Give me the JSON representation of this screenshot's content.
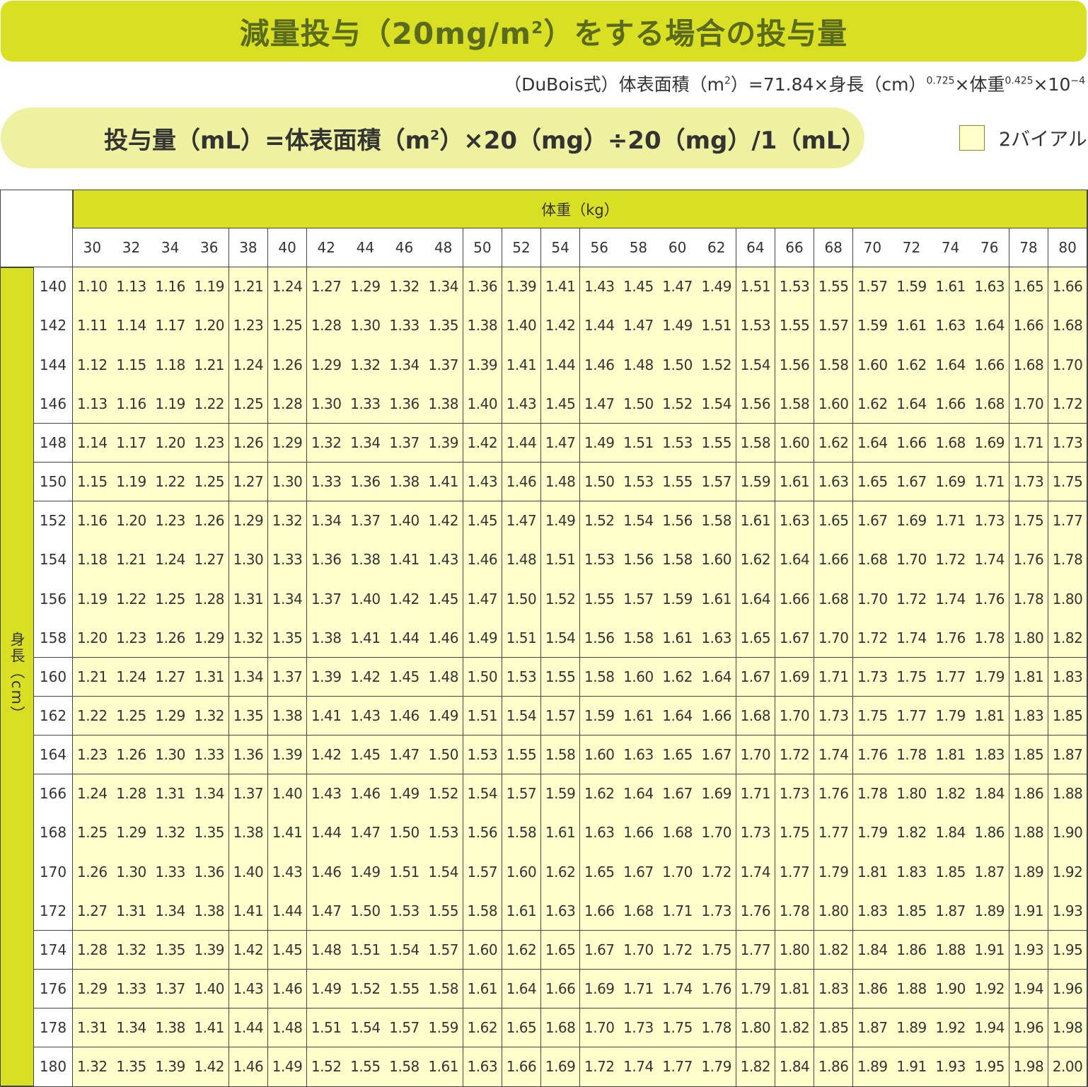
{
  "title": {
    "main": "減量投与（20mg/m",
    "sup": "2",
    "tail": "）をする場合の投与量"
  },
  "formula": {
    "part1": "（DuBois式）体表面積（m",
    "sup1": "2",
    "part2": "）=71.84×身長（cm）",
    "sup2": "0.725",
    "part3": "×体重",
    "sup3": "0.425",
    "part4": "×10",
    "sup4": "−4"
  },
  "dose": {
    "part1": "投与量（mL）=体表面積（m",
    "sup": "2",
    "part2": "）×20（mg）÷20（mg）/1（mL）"
  },
  "legend": {
    "label": "2バイアル",
    "color": "#ffffcc"
  },
  "table": {
    "weight_header": "体重（kg）",
    "height_header": "身長（cm）",
    "weights": [
      "30",
      "32",
      "34",
      "36",
      "38",
      "40",
      "42",
      "44",
      "46",
      "48",
      "50",
      "52",
      "54",
      "56",
      "58",
      "60",
      "62",
      "64",
      "66",
      "68",
      "70",
      "72",
      "74",
      "76",
      "78",
      "80"
    ],
    "heights": [
      "140",
      "142",
      "144",
      "146",
      "148",
      "150",
      "152",
      "154",
      "156",
      "158",
      "160",
      "162",
      "164",
      "166",
      "168",
      "170",
      "172",
      "174",
      "176",
      "178",
      "180"
    ],
    "values": [
      [
        "1.10",
        "1.13",
        "1.16",
        "1.19",
        "1.21",
        "1.24",
        "1.27",
        "1.29",
        "1.32",
        "1.34",
        "1.36",
        "1.39",
        "1.41",
        "1.43",
        "1.45",
        "1.47",
        "1.49",
        "1.51",
        "1.53",
        "1.55",
        "1.57",
        "1.59",
        "1.61",
        "1.63",
        "1.65",
        "1.66"
      ],
      [
        "1.11",
        "1.14",
        "1.17",
        "1.20",
        "1.23",
        "1.25",
        "1.28",
        "1.30",
        "1.33",
        "1.35",
        "1.38",
        "1.40",
        "1.42",
        "1.44",
        "1.47",
        "1.49",
        "1.51",
        "1.53",
        "1.55",
        "1.57",
        "1.59",
        "1.61",
        "1.63",
        "1.64",
        "1.66",
        "1.68"
      ],
      [
        "1.12",
        "1.15",
        "1.18",
        "1.21",
        "1.24",
        "1.26",
        "1.29",
        "1.32",
        "1.34",
        "1.37",
        "1.39",
        "1.41",
        "1.44",
        "1.46",
        "1.48",
        "1.50",
        "1.52",
        "1.54",
        "1.56",
        "1.58",
        "1.60",
        "1.62",
        "1.64",
        "1.66",
        "1.68",
        "1.70"
      ],
      [
        "1.13",
        "1.16",
        "1.19",
        "1.22",
        "1.25",
        "1.28",
        "1.30",
        "1.33",
        "1.36",
        "1.38",
        "1.40",
        "1.43",
        "1.45",
        "1.47",
        "1.50",
        "1.52",
        "1.54",
        "1.56",
        "1.58",
        "1.60",
        "1.62",
        "1.64",
        "1.66",
        "1.68",
        "1.70",
        "1.72"
      ],
      [
        "1.14",
        "1.17",
        "1.20",
        "1.23",
        "1.26",
        "1.29",
        "1.32",
        "1.34",
        "1.37",
        "1.39",
        "1.42",
        "1.44",
        "1.47",
        "1.49",
        "1.51",
        "1.53",
        "1.55",
        "1.58",
        "1.60",
        "1.62",
        "1.64",
        "1.66",
        "1.68",
        "1.69",
        "1.71",
        "1.73"
      ],
      [
        "1.15",
        "1.19",
        "1.22",
        "1.25",
        "1.27",
        "1.30",
        "1.33",
        "1.36",
        "1.38",
        "1.41",
        "1.43",
        "1.46",
        "1.48",
        "1.50",
        "1.53",
        "1.55",
        "1.57",
        "1.59",
        "1.61",
        "1.63",
        "1.65",
        "1.67",
        "1.69",
        "1.71",
        "1.73",
        "1.75"
      ],
      [
        "1.16",
        "1.20",
        "1.23",
        "1.26",
        "1.29",
        "1.32",
        "1.34",
        "1.37",
        "1.40",
        "1.42",
        "1.45",
        "1.47",
        "1.49",
        "1.52",
        "1.54",
        "1.56",
        "1.58",
        "1.61",
        "1.63",
        "1.65",
        "1.67",
        "1.69",
        "1.71",
        "1.73",
        "1.75",
        "1.77"
      ],
      [
        "1.18",
        "1.21",
        "1.24",
        "1.27",
        "1.30",
        "1.33",
        "1.36",
        "1.38",
        "1.41",
        "1.43",
        "1.46",
        "1.48",
        "1.51",
        "1.53",
        "1.56",
        "1.58",
        "1.60",
        "1.62",
        "1.64",
        "1.66",
        "1.68",
        "1.70",
        "1.72",
        "1.74",
        "1.76",
        "1.78"
      ],
      [
        "1.19",
        "1.22",
        "1.25",
        "1.28",
        "1.31",
        "1.34",
        "1.37",
        "1.40",
        "1.42",
        "1.45",
        "1.47",
        "1.50",
        "1.52",
        "1.55",
        "1.57",
        "1.59",
        "1.61",
        "1.64",
        "1.66",
        "1.68",
        "1.70",
        "1.72",
        "1.74",
        "1.76",
        "1.78",
        "1.80"
      ],
      [
        "1.20",
        "1.23",
        "1.26",
        "1.29",
        "1.32",
        "1.35",
        "1.38",
        "1.41",
        "1.44",
        "1.46",
        "1.49",
        "1.51",
        "1.54",
        "1.56",
        "1.58",
        "1.61",
        "1.63",
        "1.65",
        "1.67",
        "1.70",
        "1.72",
        "1.74",
        "1.76",
        "1.78",
        "1.80",
        "1.82"
      ],
      [
        "1.21",
        "1.24",
        "1.27",
        "1.31",
        "1.34",
        "1.37",
        "1.39",
        "1.42",
        "1.45",
        "1.48",
        "1.50",
        "1.53",
        "1.55",
        "1.58",
        "1.60",
        "1.62",
        "1.64",
        "1.67",
        "1.69",
        "1.71",
        "1.73",
        "1.75",
        "1.77",
        "1.79",
        "1.81",
        "1.83"
      ],
      [
        "1.22",
        "1.25",
        "1.29",
        "1.32",
        "1.35",
        "1.38",
        "1.41",
        "1.43",
        "1.46",
        "1.49",
        "1.51",
        "1.54",
        "1.57",
        "1.59",
        "1.61",
        "1.64",
        "1.66",
        "1.68",
        "1.70",
        "1.73",
        "1.75",
        "1.77",
        "1.79",
        "1.81",
        "1.83",
        "1.85"
      ],
      [
        "1.23",
        "1.26",
        "1.30",
        "1.33",
        "1.36",
        "1.39",
        "1.42",
        "1.45",
        "1.47",
        "1.50",
        "1.53",
        "1.55",
        "1.58",
        "1.60",
        "1.63",
        "1.65",
        "1.67",
        "1.70",
        "1.72",
        "1.74",
        "1.76",
        "1.78",
        "1.81",
        "1.83",
        "1.85",
        "1.87"
      ],
      [
        "1.24",
        "1.28",
        "1.31",
        "1.34",
        "1.37",
        "1.40",
        "1.43",
        "1.46",
        "1.49",
        "1.52",
        "1.54",
        "1.57",
        "1.59",
        "1.62",
        "1.64",
        "1.67",
        "1.69",
        "1.71",
        "1.73",
        "1.76",
        "1.78",
        "1.80",
        "1.82",
        "1.84",
        "1.86",
        "1.88"
      ],
      [
        "1.25",
        "1.29",
        "1.32",
        "1.35",
        "1.38",
        "1.41",
        "1.44",
        "1.47",
        "1.50",
        "1.53",
        "1.56",
        "1.58",
        "1.61",
        "1.63",
        "1.66",
        "1.68",
        "1.70",
        "1.73",
        "1.75",
        "1.77",
        "1.79",
        "1.82",
        "1.84",
        "1.86",
        "1.88",
        "1.90"
      ],
      [
        "1.26",
        "1.30",
        "1.33",
        "1.36",
        "1.40",
        "1.43",
        "1.46",
        "1.49",
        "1.51",
        "1.54",
        "1.57",
        "1.60",
        "1.62",
        "1.65",
        "1.67",
        "1.70",
        "1.72",
        "1.74",
        "1.77",
        "1.79",
        "1.81",
        "1.83",
        "1.85",
        "1.87",
        "1.89",
        "1.92"
      ],
      [
        "1.27",
        "1.31",
        "1.34",
        "1.38",
        "1.41",
        "1.44",
        "1.47",
        "1.50",
        "1.53",
        "1.55",
        "1.58",
        "1.61",
        "1.63",
        "1.66",
        "1.68",
        "1.71",
        "1.73",
        "1.76",
        "1.78",
        "1.80",
        "1.83",
        "1.85",
        "1.87",
        "1.89",
        "1.91",
        "1.93"
      ],
      [
        "1.28",
        "1.32",
        "1.35",
        "1.39",
        "1.42",
        "1.45",
        "1.48",
        "1.51",
        "1.54",
        "1.57",
        "1.60",
        "1.62",
        "1.65",
        "1.67",
        "1.70",
        "1.72",
        "1.75",
        "1.77",
        "1.80",
        "1.82",
        "1.84",
        "1.86",
        "1.88",
        "1.91",
        "1.93",
        "1.95"
      ],
      [
        "1.29",
        "1.33",
        "1.37",
        "1.40",
        "1.43",
        "1.46",
        "1.49",
        "1.52",
        "1.55",
        "1.58",
        "1.61",
        "1.64",
        "1.66",
        "1.69",
        "1.71",
        "1.74",
        "1.76",
        "1.79",
        "1.81",
        "1.83",
        "1.86",
        "1.88",
        "1.90",
        "1.92",
        "1.94",
        "1.96"
      ],
      [
        "1.31",
        "1.34",
        "1.38",
        "1.41",
        "1.44",
        "1.48",
        "1.51",
        "1.54",
        "1.57",
        "1.59",
        "1.62",
        "1.65",
        "1.68",
        "1.70",
        "1.73",
        "1.75",
        "1.78",
        "1.80",
        "1.82",
        "1.85",
        "1.87",
        "1.89",
        "1.92",
        "1.94",
        "1.96",
        "1.98"
      ],
      [
        "1.32",
        "1.35",
        "1.39",
        "1.42",
        "1.46",
        "1.49",
        "1.52",
        "1.55",
        "1.58",
        "1.61",
        "1.63",
        "1.66",
        "1.69",
        "1.72",
        "1.74",
        "1.77",
        "1.79",
        "1.82",
        "1.84",
        "1.86",
        "1.89",
        "1.91",
        "1.93",
        "1.95",
        "1.98",
        "2.00"
      ]
    ]
  }
}
